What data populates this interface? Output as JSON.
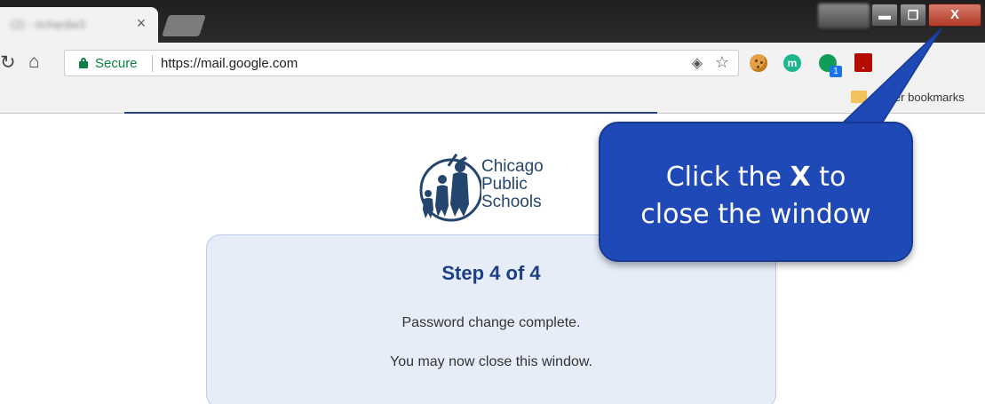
{
  "browser": {
    "tab": {
      "title": "(2) - richardw3",
      "close_glyph": "×"
    },
    "window_controls": {
      "minimize": "▬",
      "maximize": "❐",
      "close": "X"
    },
    "toolbar": {
      "security_label": "Secure",
      "url": "https://mail.google.com",
      "extension_badge": "1"
    },
    "bookmarks_bar": {
      "other_bookmarks_label": "Other bookmarks"
    }
  },
  "page": {
    "logo": {
      "line1": "Chicago",
      "line2": "Public",
      "line3": "Schools"
    },
    "card": {
      "title": "Step 4 of 4",
      "message1": "Password change complete.",
      "message2": "You may now close this window."
    }
  },
  "callout": {
    "line1_before": "Click the ",
    "line1_bold": "X",
    "line1_after": " to",
    "line2": "close the window"
  },
  "colors": {
    "accent_blue": "#1f49b6",
    "secure_green": "#0b8043",
    "card_bg": "#e6edf9",
    "title_blue": "#1d3f86"
  }
}
